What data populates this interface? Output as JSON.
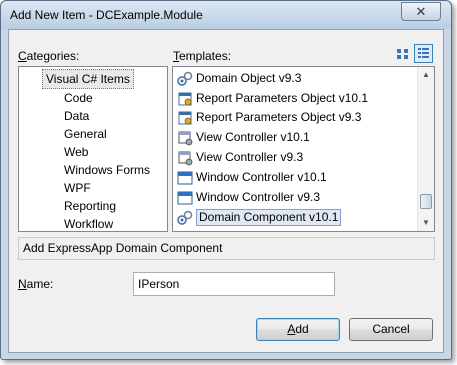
{
  "window": {
    "title": "Add New Item - DCExample.Module",
    "close_glyph": "✕"
  },
  "categories": {
    "label": "Categories:",
    "label_mnemonic": "C",
    "label_rest": "ategories:",
    "root": "Visual C# Items",
    "items": [
      "Code",
      "Data",
      "General",
      "Web",
      "Windows Forms",
      "WPF",
      "Reporting",
      "Workflow"
    ]
  },
  "templates": {
    "label_mnemonic": "T",
    "label_rest": "emplates:",
    "items": [
      {
        "label": "Domain Object v9.3",
        "icon": "domain-object-icon"
      },
      {
        "label": "Report Parameters Object v10.1",
        "icon": "report-parameters-icon"
      },
      {
        "label": "Report Parameters Object v9.3",
        "icon": "report-parameters-icon"
      },
      {
        "label": "View Controller  v10.1",
        "icon": "view-controller-icon"
      },
      {
        "label": "View Controller  v9.3",
        "icon": "view-controller-icon"
      },
      {
        "label": "Window Controller v10.1",
        "icon": "window-controller-icon"
      },
      {
        "label": "Window Controller v9.3",
        "icon": "window-controller-icon"
      },
      {
        "label": "Domain Component v10.1",
        "icon": "domain-component-icon"
      }
    ],
    "selected_index": 7
  },
  "description": "Add ExpressApp Domain Component",
  "name_field": {
    "label_mnemonic": "N",
    "label_rest": "ame:",
    "value": "IPerson"
  },
  "buttons": {
    "add_mnemonic": "A",
    "add_rest": "dd",
    "cancel": "Cancel"
  },
  "colors": {
    "title_gradient_top": "#dde8f3",
    "title_gradient_bottom": "#b9cde2",
    "selection_border": "#7da2ce",
    "selection_fill": "#dfe8f4"
  }
}
